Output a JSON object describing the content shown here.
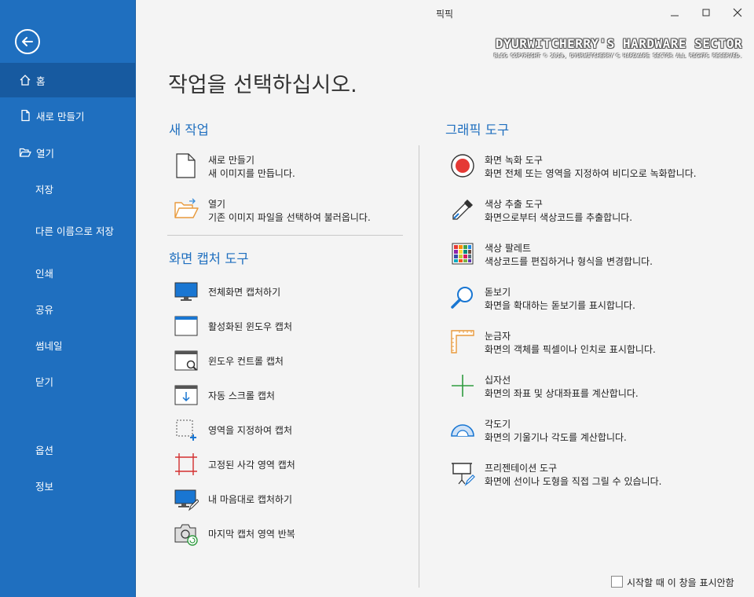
{
  "window": {
    "title": "픽픽"
  },
  "watermark": {
    "line1": "DYURWITCHERRY'S HARDWARE SECTOR",
    "line2": "BLOG COPYRIGHT © 2010, DYURWITCHERRY'S HARDWARE SECTOR ALL RIGHTS RESERVED."
  },
  "sidebar": {
    "items": [
      {
        "label": "홈",
        "icon": "home-icon"
      },
      {
        "label": "새로 만들기",
        "icon": "new-file-icon"
      },
      {
        "label": "열기",
        "icon": "folder-open-icon"
      },
      {
        "label": "저장"
      },
      {
        "label": "다른 이름으로 저장"
      },
      {
        "label": "인쇄"
      },
      {
        "label": "공유"
      },
      {
        "label": "썸네일"
      },
      {
        "label": "닫기"
      },
      {
        "label": "옵션"
      },
      {
        "label": "정보"
      }
    ]
  },
  "main": {
    "heading": "작업을 선택하십시오.",
    "new_task": {
      "title": "새 작업",
      "items": [
        {
          "name": "새로 만들기",
          "desc": "새 이미지를 만듭니다."
        },
        {
          "name": "열기",
          "desc": "기존 이미지 파일을 선택하여 불러옵니다."
        }
      ]
    },
    "capture": {
      "title": "화면 캡처 도구",
      "items": [
        {
          "name": "전체화면 캡처하기"
        },
        {
          "name": "활성화된 윈도우 캡처"
        },
        {
          "name": "윈도우 컨트롤 캡처"
        },
        {
          "name": "자동 스크롤 캡처"
        },
        {
          "name": "영역을 지정하여 캡처"
        },
        {
          "name": "고정된 사각 영역 캡처"
        },
        {
          "name": "내 마음대로 캡처하기"
        },
        {
          "name": "마지막 캡처 영역 반복"
        }
      ]
    },
    "graphic": {
      "title": "그래픽 도구",
      "items": [
        {
          "name": "화면 녹화 도구",
          "desc": "화면 전체 또는 영역을 지정하여 비디오로 녹화합니다."
        },
        {
          "name": "색상 추출 도구",
          "desc": "화면으로부터 색상코드를 추출합니다."
        },
        {
          "name": "색상 팔레트",
          "desc": "색상코드를 편집하거나 형식을 변경합니다."
        },
        {
          "name": "돋보기",
          "desc": "화면을 확대하는 돋보기를 표시합니다."
        },
        {
          "name": "눈금자",
          "desc": "화면의 객체를 픽셀이나 인치로 표시합니다."
        },
        {
          "name": "십자선",
          "desc": "화면의 좌표 및 상대좌표를 계산합니다."
        },
        {
          "name": "각도기",
          "desc": "화면의 기울기나 각도를 계산합니다."
        },
        {
          "name": "프리젠테이션 도구",
          "desc": "화면에 선이나 도형을 직접 그릴 수 있습니다."
        }
      ]
    },
    "dont_show_label": "시작할 때 이 창을 표시안함"
  },
  "colors": {
    "sidebar_bg": "#1f6fbf",
    "sidebar_active": "#175aa0",
    "accent": "#1f6fbf",
    "record_red": "#e53935"
  }
}
